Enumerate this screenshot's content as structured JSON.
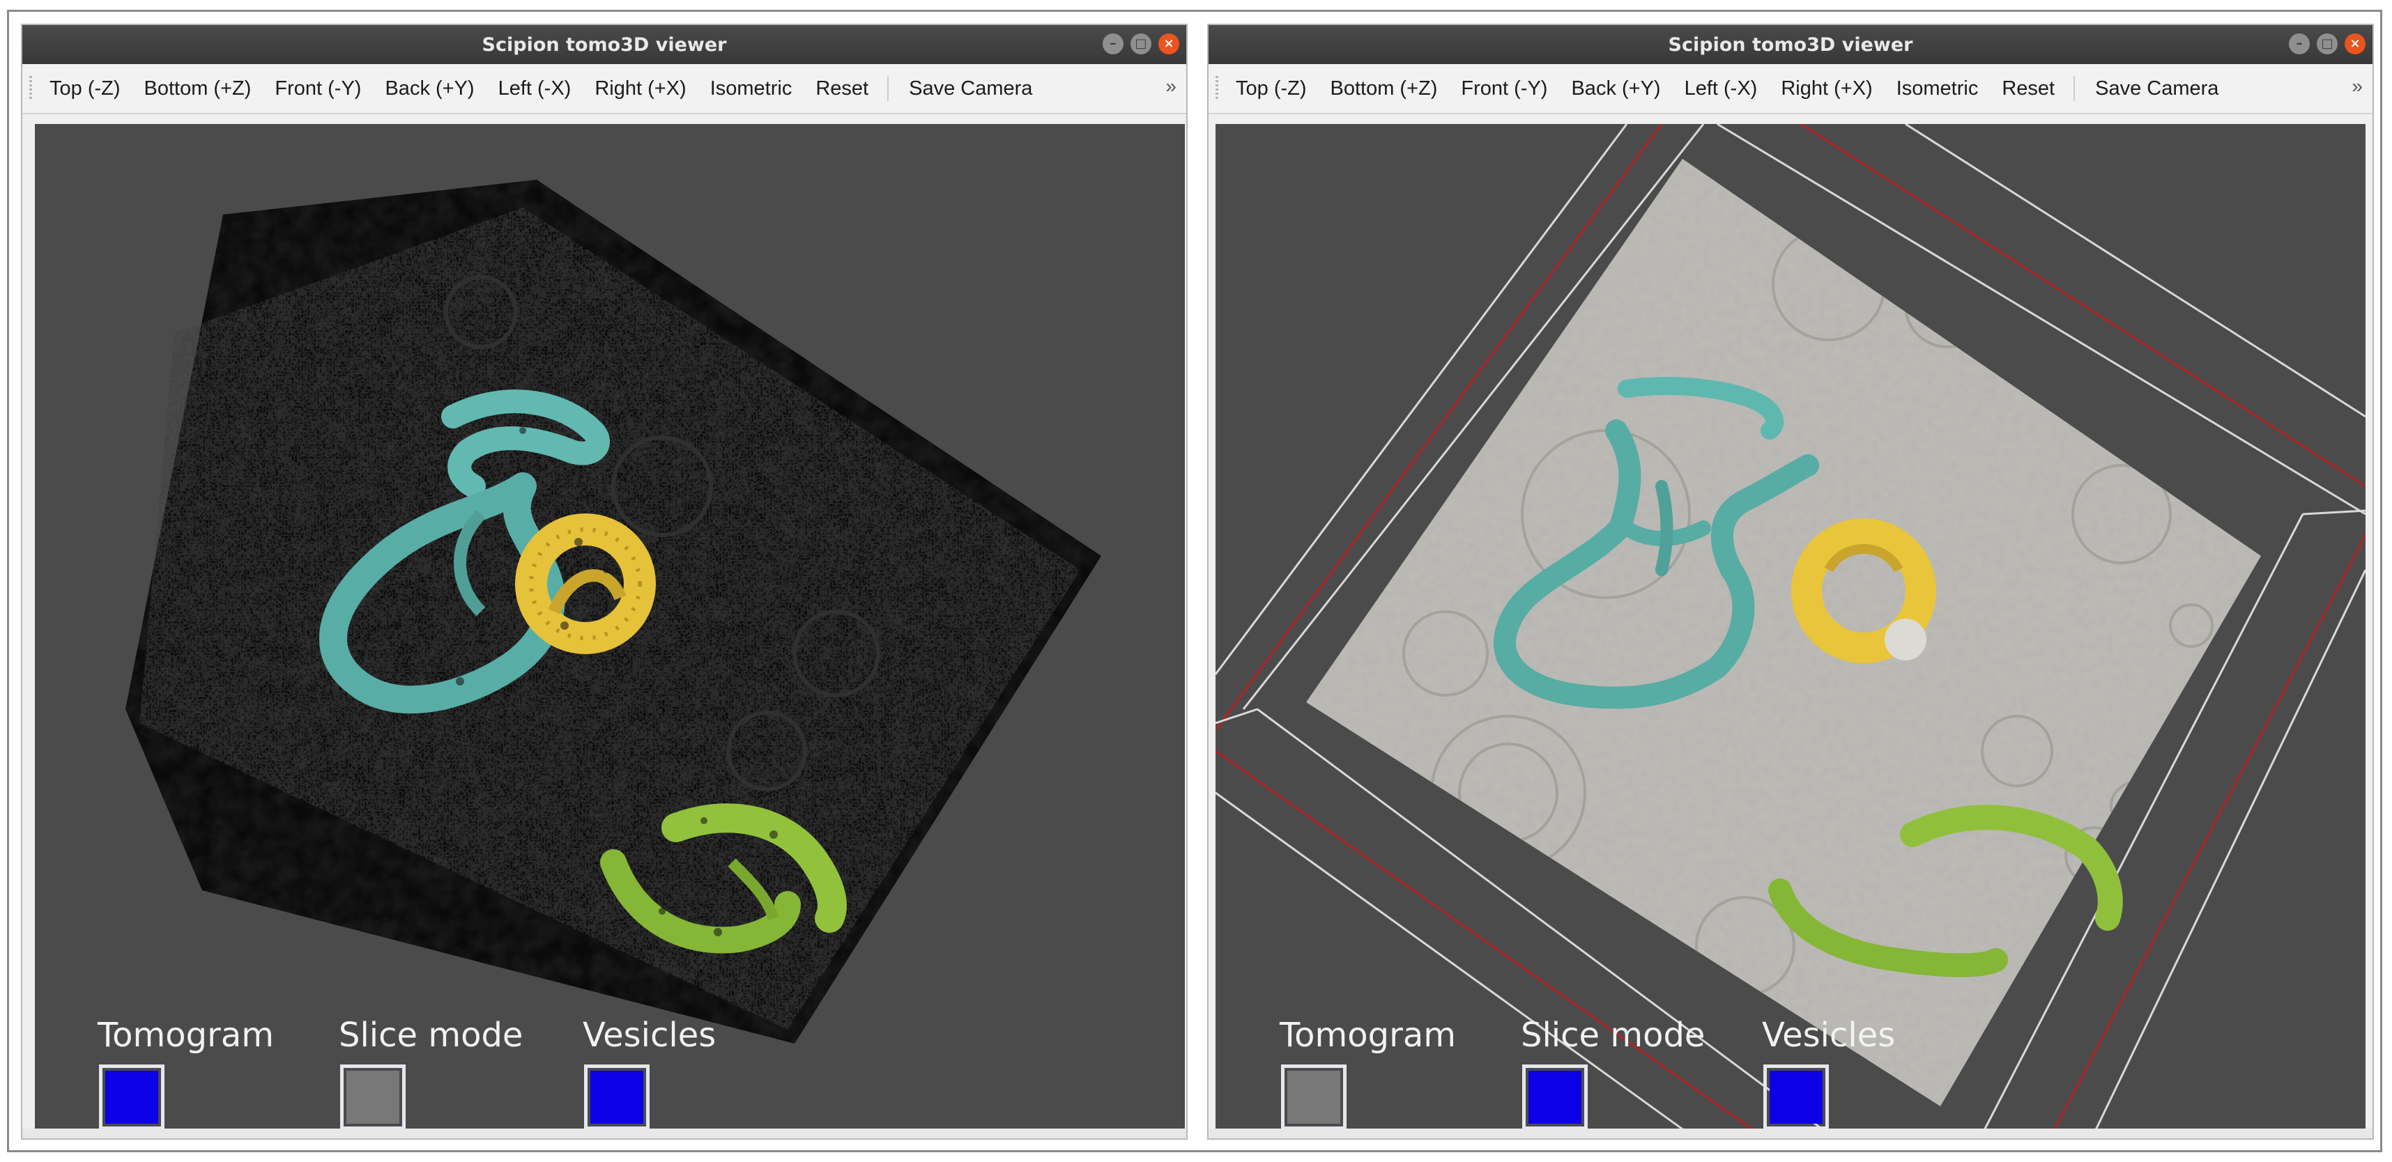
{
  "colors": {
    "titlebar": "#3c3c3c",
    "viewport_bg": "#4b4b4b",
    "toggle_on": "#0b00e6",
    "toggle_off": "#787878",
    "membrane_teal": "#5fb8b0",
    "membrane_yellow": "#e8c53a",
    "membrane_green": "#8fc03a",
    "tomo_slice": "#bdbbb6"
  },
  "windows": [
    {
      "title": "Scipion tomo3D viewer",
      "toolbar": [
        "Top (-Z)",
        "Bottom (+Z)",
        "Front (-Y)",
        "Back (+Y)",
        "Left (-X)",
        "Right (+X)",
        "Isometric",
        "Reset"
      ],
      "save_camera": "Save Camera",
      "more": "»",
      "legend": [
        {
          "label": "Tomogram",
          "state": "on"
        },
        {
          "label": "Slice mode",
          "state": "off"
        },
        {
          "label": "Vesicles",
          "state": "on"
        }
      ]
    },
    {
      "title": "Scipion tomo3D viewer",
      "toolbar": [
        "Top (-Z)",
        "Bottom (+Z)",
        "Front (-Y)",
        "Back (+Y)",
        "Left (-X)",
        "Right (+X)",
        "Isometric",
        "Reset"
      ],
      "save_camera": "Save Camera",
      "more": "»",
      "legend": [
        {
          "label": "Tomogram",
          "state": "off"
        },
        {
          "label": "Slice mode",
          "state": "on"
        },
        {
          "label": "Vesicles",
          "state": "on"
        }
      ]
    }
  ]
}
